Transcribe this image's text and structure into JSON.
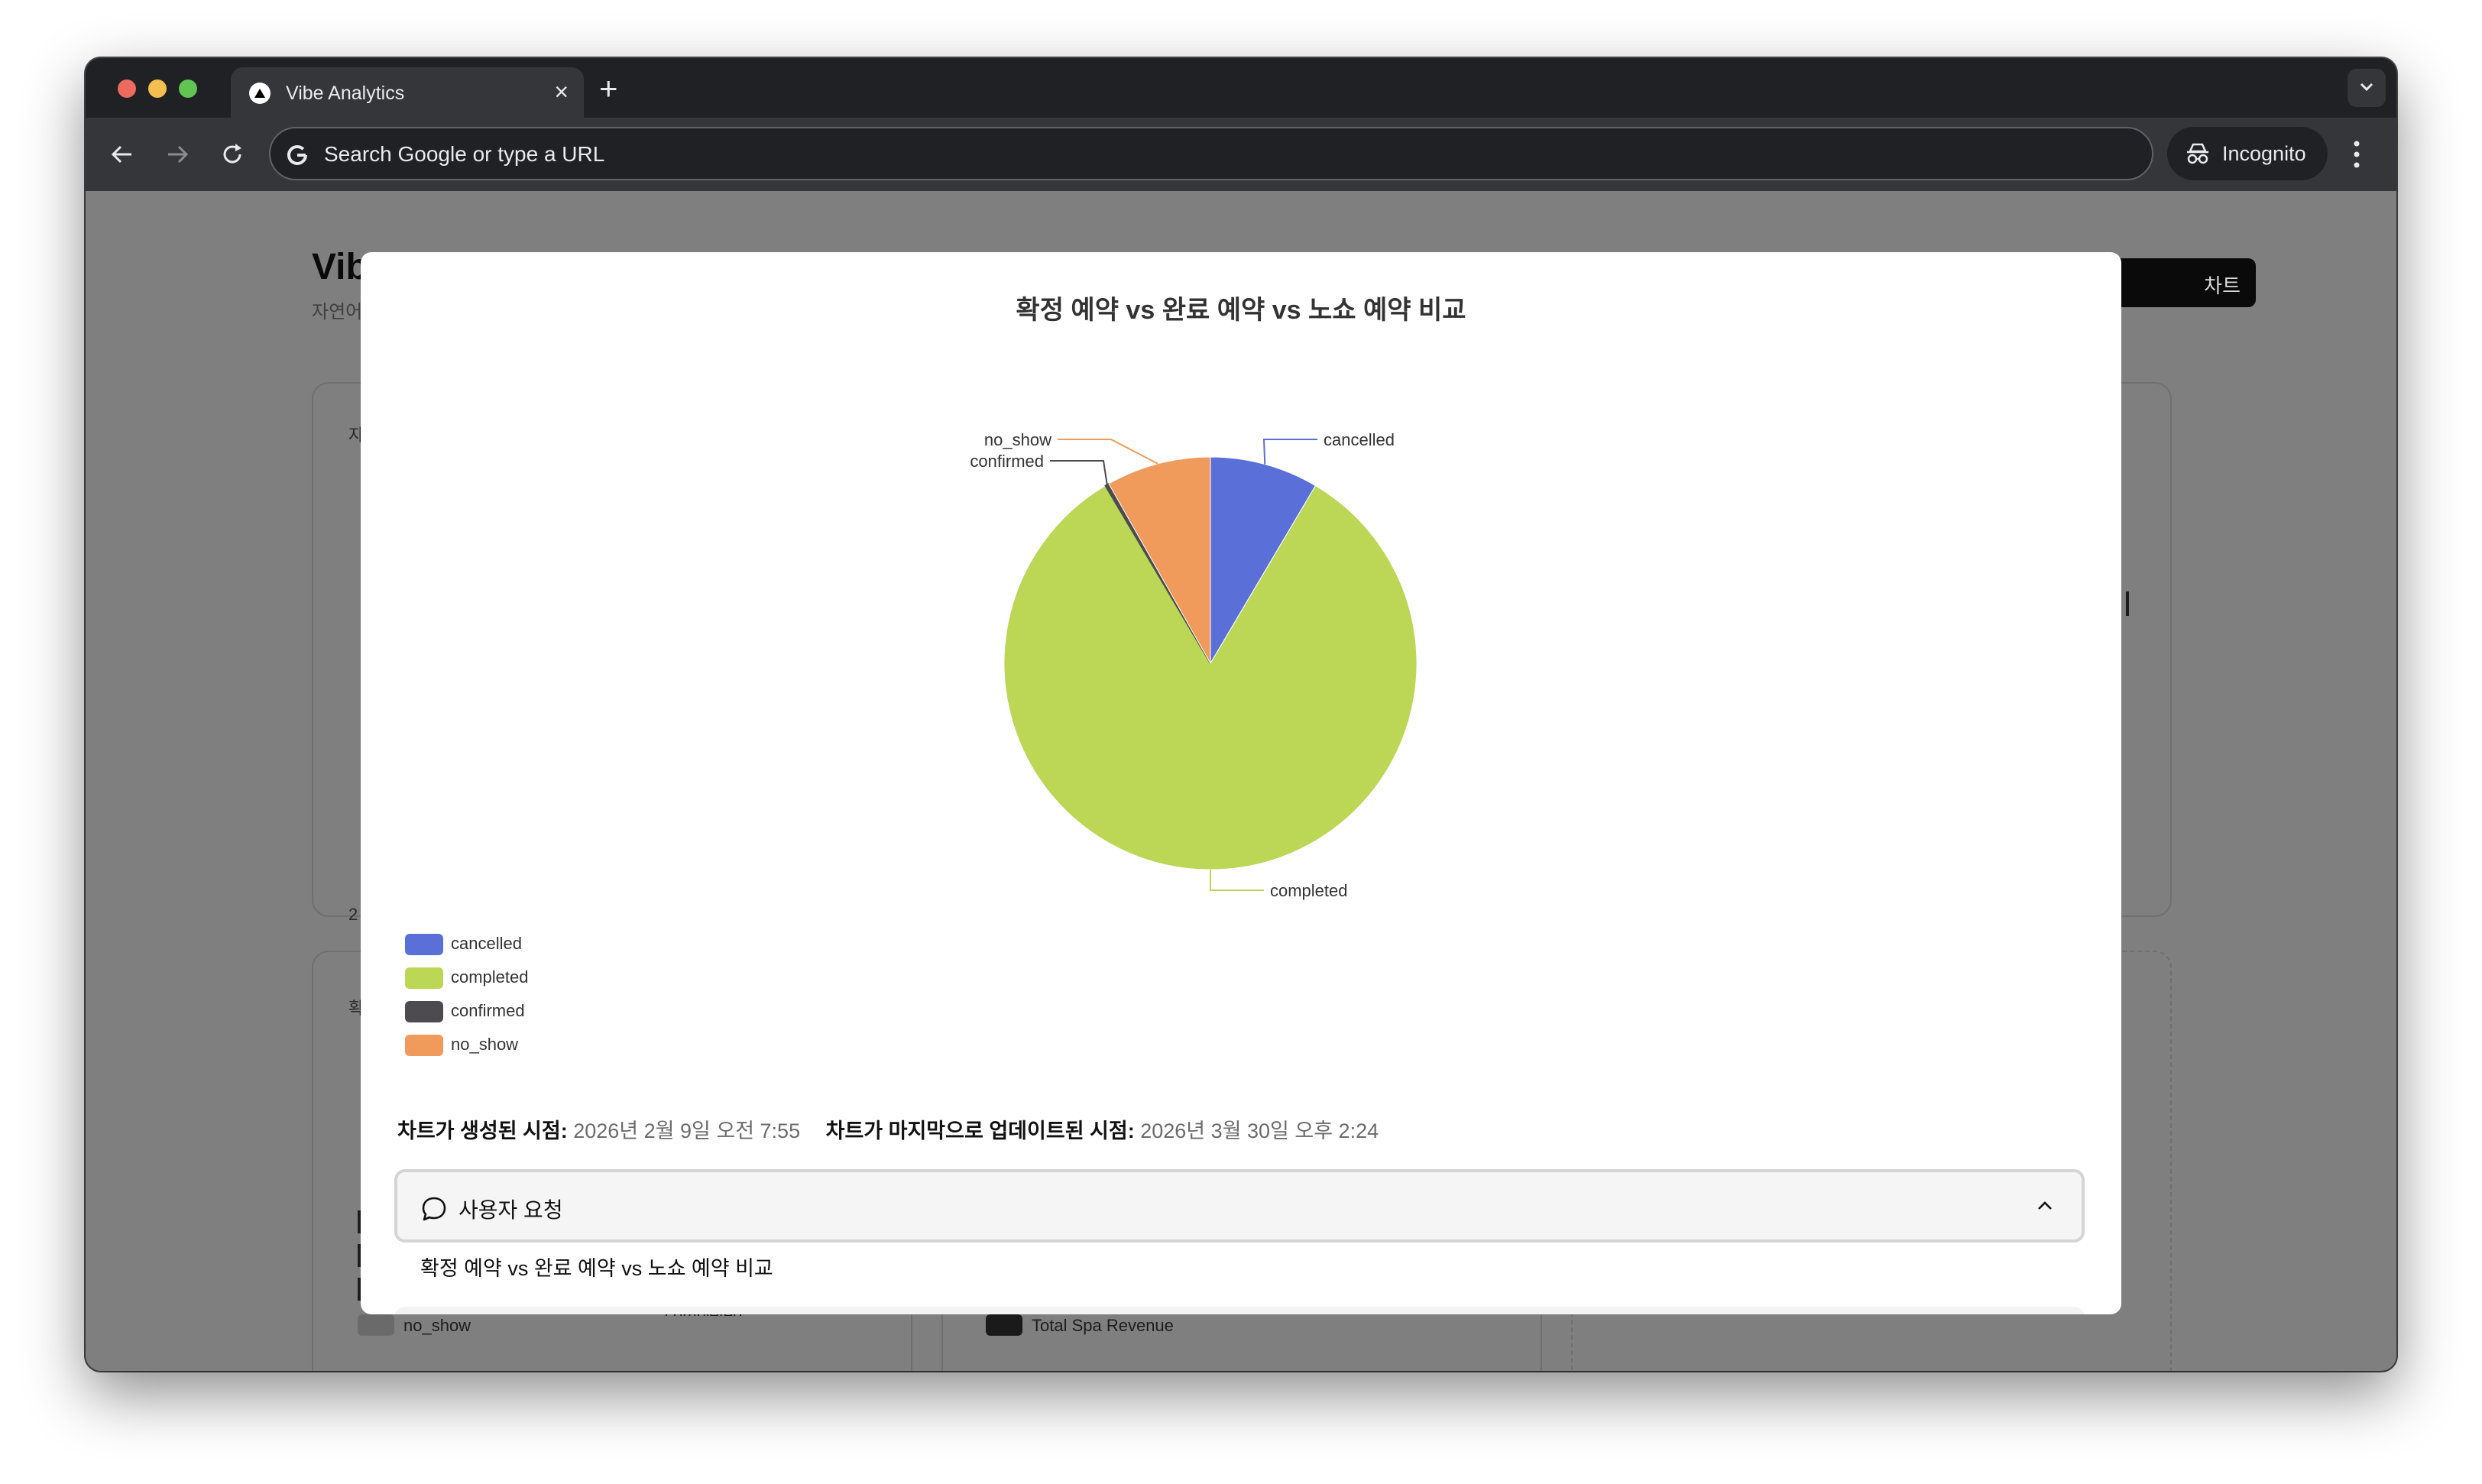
{
  "browser": {
    "tab_title": "Vibe Analytics",
    "tab_close": "×",
    "new_tab": "+",
    "omnibox_placeholder": "Search Google or type a URL",
    "incognito_label": "Incognito"
  },
  "background_page": {
    "title_fragment": "Vib",
    "subtitle_fragment": "자연어",
    "button_fragment": "차트",
    "legend_no_show": "no_show",
    "completed_fragment": "completed",
    "legend_total_spa_revenue": "Total Spa Revenue",
    "left_card_fragment_1": "자",
    "left_card_fragment_2": "2",
    "left_card_fragment_3": "확"
  },
  "modal": {
    "chart_title": "확정 예약 vs 완료 예약 vs 노쇼 예약 비교",
    "created_label": "차트가 생성된 시점:",
    "created_value": "2026년 2월 9일 오전 7:55",
    "updated_label": "차트가 마지막으로 업데이트된 시점:",
    "updated_value": "2026년 3월 30일 오후 2:24",
    "user_request_label": "사용자 요청",
    "user_request_text": "확정 예약 vs 완료 예약 vs 노쇼 예약 비교"
  },
  "chart_data": {
    "type": "pie",
    "title": "확정 예약 vs 완료 예약 vs 노쇼 예약 비교",
    "categories": [
      "cancelled",
      "completed",
      "confirmed",
      "no_show"
    ],
    "values": [
      8.5,
      83,
      0.3,
      8.2
    ],
    "colors": [
      "#5a6fd8",
      "#bcd655",
      "#4d4b4f",
      "#f09a5b"
    ],
    "legend_position": "bottom-left",
    "start_angle": "12 o'clock, clockwise"
  }
}
